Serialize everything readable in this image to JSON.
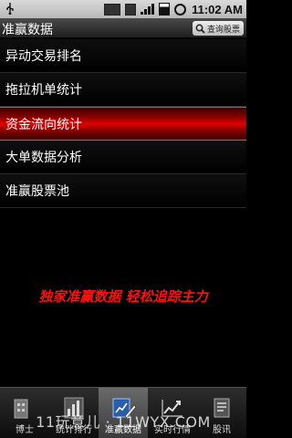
{
  "status_bar": {
    "time": "11:02 AM",
    "icons": [
      "usb-icon",
      "sd-card-icon",
      "signal-icon",
      "battery-icon",
      "alarm-icon"
    ]
  },
  "header": {
    "title": "准赢数据",
    "search_label": "查询股票"
  },
  "menu": {
    "items": [
      {
        "label": "异动交易排名"
      },
      {
        "label": "拖拉机单统计"
      },
      {
        "label": "资金流向统计",
        "selected": true
      },
      {
        "label": "大单数据分析"
      },
      {
        "label": "准赢股票池"
      }
    ]
  },
  "slogan": "独家准赢数据 轻松追踪主力",
  "tabs": [
    {
      "label": "博士",
      "icon": "building-icon"
    },
    {
      "label": "统计排行",
      "icon": "bar-chart-icon"
    },
    {
      "label": "准赢数据",
      "icon": "edit-chart-icon",
      "active": true
    },
    {
      "label": "实时行情",
      "icon": "trend-icon"
    },
    {
      "label": "股讯",
      "icon": "news-icon"
    }
  ],
  "watermark": "11玩意儿 · 11WYX.COM",
  "colors": {
    "accent_red": "#e00000",
    "slogan_red": "#ff1010"
  }
}
